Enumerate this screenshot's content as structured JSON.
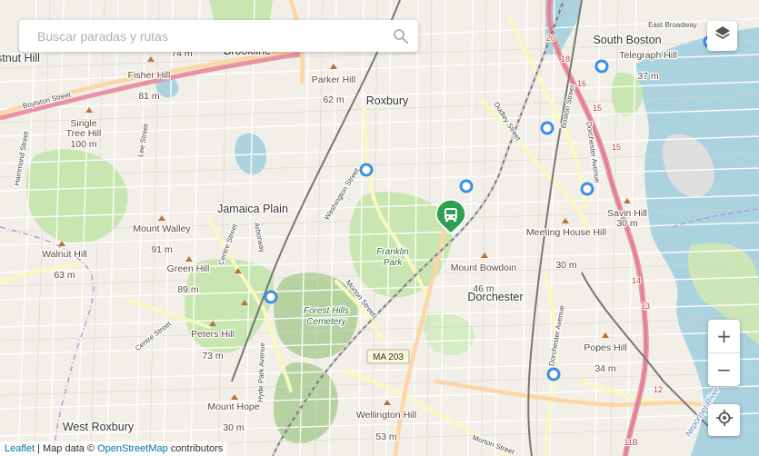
{
  "search": {
    "placeholder": "Buscar paradas y rutas"
  },
  "controls": {
    "layers_icon": "layers-icon",
    "zoom_in_label": "+",
    "zoom_out_label": "−",
    "locate_icon": "locate-icon"
  },
  "attribution": {
    "leaflet": "Leaflet",
    "separator": " | Map data © ",
    "osm": "OpenStreetMap",
    "suffix": " contributors"
  },
  "map_labels": {
    "south_boston": "South Boston",
    "roxbury": "Roxbury",
    "jamaica_plain": "Jamaica Plain",
    "dorchester": "Dorchester",
    "west_roxbury": "West Roxbury",
    "brookline": "Brookline",
    "chestnut_hill": "stnut Hill",
    "east_broadway": "East Broadway",
    "fisher_hill": "Fisher Hill",
    "fisher_hill_elev": "81 m",
    "brookline_elev": "74 m",
    "single_tree_hill_1": "Single",
    "single_tree_hill_2": "Tree Hill",
    "single_tree_hill_elev": "100 m",
    "parker_hill": "Parker Hill",
    "parker_hill_elev": "62 m",
    "telegraph_hill": "Telegraph Hill",
    "telegraph_hill_elev": "37 m",
    "savin_hill": "Savin Hill",
    "savin_hill_elev": "30 m",
    "meeting_house_hill": "Meeting House Hill",
    "meeting_house_hill_elev": "30 m",
    "mount_bowdoin": "Mount Bowdoin",
    "mount_bowdoin_elev": "46 m",
    "popes_hill": "Popes Hill",
    "popes_hill_elev": "34 m",
    "mount_walley": "Mount Walley",
    "mount_walley_elev": "91 m",
    "walnut_hill": "Walnut Hill",
    "walnut_hill_elev": "63 m",
    "green_hill": "Green Hill",
    "green_hill_elev": "89 m",
    "peters_hill": "Peters Hill",
    "peters_hill_elev": "73 m",
    "mount_hope": "Mount Hope",
    "mount_hope_elev": "30 m",
    "wellington_hill": "Wellington Hill",
    "wellington_hill_elev": "53 m",
    "franklin_park_1": "Franklin",
    "franklin_park_2": "Park",
    "forest_hills_1": "Forest Hills",
    "forest_hills_2": "Cemetery",
    "boylston_street": "Boylston Street",
    "hammond_street": "Hammond Street",
    "lee_street": "Lee Street",
    "washington_street": "Washington Street",
    "dudley_street": "Dudley Street",
    "boston_street": "Boston Street",
    "dorchester_avenue_1": "Dorchester Avenue",
    "dorchester_avenue_2": "Dorchester Avenue",
    "arborway": "Arborway",
    "centre_street_1": "Centre Street",
    "centre_street_2": "Centre Street",
    "morton_street_1": "Morton Street",
    "morton_street_2": "Morton Street",
    "hyde_park_avenue": "Hyde Park Avenue",
    "ma_203": "MA 203",
    "neponset_river": "Neponset River",
    "route_20": "20",
    "route_18": "18",
    "route_16": "16",
    "route_15a": "15",
    "route_15b": "15",
    "route_14": "14",
    "route_13": "13",
    "route_12": "12",
    "route_11b": "11B"
  },
  "colors": {
    "land": "#f2efe9",
    "park": "#c8e6b0",
    "water": "#aad3df",
    "highway": "#e892a2",
    "primary": "#fcd6a4",
    "secondary": "#f7fabf",
    "rail": "#777777",
    "stop_ring": "#3d8fe0",
    "selected_marker": "#2ea04f"
  },
  "markers": [
    {
      "type": "bus-stop",
      "name": "bus-stop-1"
    },
    {
      "type": "bus-stop",
      "name": "bus-stop-2"
    },
    {
      "type": "bus-stop",
      "name": "bus-stop-3"
    },
    {
      "type": "bus-stop",
      "name": "bus-stop-4"
    },
    {
      "type": "bus-stop",
      "name": "bus-stop-5"
    },
    {
      "type": "bus-stop",
      "name": "bus-stop-6"
    },
    {
      "type": "bus-stop",
      "name": "bus-stop-7"
    },
    {
      "type": "bus-stop",
      "name": "bus-stop-8"
    }
  ],
  "selected_marker": {
    "icon": "bus-icon"
  }
}
